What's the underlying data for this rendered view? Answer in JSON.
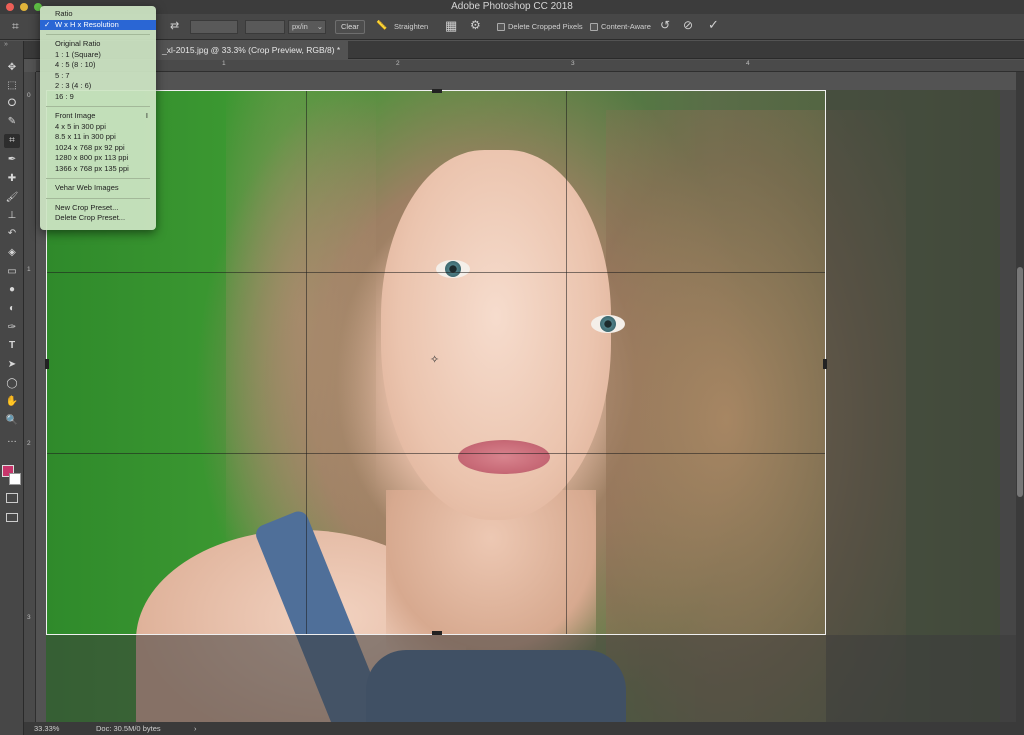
{
  "app": {
    "title": "Adobe Photoshop CC 2018"
  },
  "options_bar": {
    "unit_select": "px/in",
    "clear_label": "Clear",
    "straighten_label": "Straighten",
    "delete_cropped_label": "Delete Cropped Pixels",
    "content_aware_label": "Content-Aware"
  },
  "document": {
    "tab_label": "_xl-2015.jpg @ 33.3% (Crop Preview, RGB/8) *"
  },
  "rulers": {
    "top": [
      "1",
      "2",
      "3",
      "4"
    ],
    "left": [
      "0",
      "1",
      "2",
      "3"
    ]
  },
  "crop_menu": {
    "items": [
      {
        "label": "Ratio",
        "selected": false
      },
      {
        "label": "W x H x Resolution",
        "selected": true
      },
      {
        "label": "Original Ratio",
        "selected": false
      },
      {
        "label": "1 : 1 (Square)",
        "selected": false
      },
      {
        "label": "4 : 5 (8 : 10)",
        "selected": false
      },
      {
        "label": "5 : 7",
        "selected": false
      },
      {
        "label": "2 : 3 (4 : 6)",
        "selected": false
      },
      {
        "label": "16 : 9",
        "selected": false
      },
      {
        "label": "Front Image",
        "selected": false,
        "shortcut": "I"
      },
      {
        "label": "4 x 5 in 300 ppi",
        "selected": false
      },
      {
        "label": "8.5 x 11 in 300 ppi",
        "selected": false
      },
      {
        "label": "1024 x 768 px 92 ppi",
        "selected": false
      },
      {
        "label": "1280 x 800 px 113 ppi",
        "selected": false
      },
      {
        "label": "1366 x 768 px 135 ppi",
        "selected": false
      },
      {
        "label": "Vehar Web Images",
        "selected": false
      },
      {
        "label": "New Crop Preset...",
        "selected": false
      },
      {
        "label": "Delete Crop Preset...",
        "selected": false
      }
    ]
  },
  "status": {
    "zoom": "33.33%",
    "doc_size": "Doc: 30.5M/0 bytes",
    "arrow": "›"
  },
  "colors": {
    "foreground": "#c8356b",
    "background": "#ffffff"
  },
  "icons": {
    "tools": [
      "move-icon",
      "marquee-icon",
      "lasso-icon",
      "quick-select-icon",
      "crop-icon",
      "eyedropper-icon",
      "healing-icon",
      "brush-icon",
      "stamp-icon",
      "history-brush-icon",
      "eraser-icon",
      "gradient-icon",
      "blur-icon",
      "dodge-icon",
      "pen-icon",
      "type-icon",
      "path-select-icon",
      "shape-icon",
      "hand-icon",
      "zoom-icon",
      "more-tools-icon"
    ]
  }
}
